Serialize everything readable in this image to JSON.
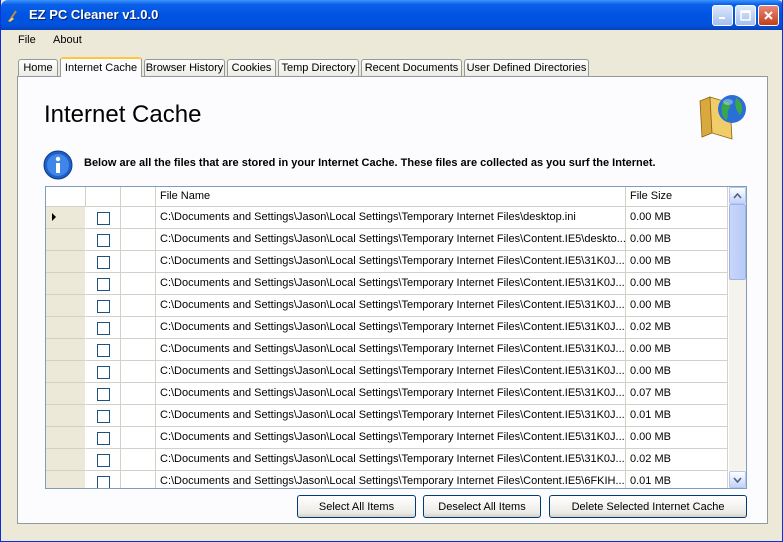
{
  "window": {
    "title": "EZ PC Cleaner v1.0.0"
  },
  "menu": {
    "items": [
      "File",
      "About"
    ]
  },
  "tabs": [
    {
      "label": "Home"
    },
    {
      "label": "Internet Cache"
    },
    {
      "label": "Browser History"
    },
    {
      "label": "Cookies"
    },
    {
      "label": "Temp Directory"
    },
    {
      "label": "Recent Documents"
    },
    {
      "label": "User Defined Directories"
    }
  ],
  "active_tab": "Internet Cache",
  "panel": {
    "heading": "Internet Cache",
    "info_text": "Below are all the files that are stored in your Internet Cache. These files are collected as you surf the Internet."
  },
  "grid": {
    "columns": [
      "File Name",
      "File Size"
    ],
    "rows": [
      {
        "file": "C:\\Documents and Settings\\Jason\\Local Settings\\Temporary Internet Files\\desktop.ini",
        "size": "0.00 MB"
      },
      {
        "file": "C:\\Documents and Settings\\Jason\\Local Settings\\Temporary Internet Files\\Content.IE5\\deskto...",
        "size": "0.00 MB"
      },
      {
        "file": "C:\\Documents and Settings\\Jason\\Local Settings\\Temporary Internet Files\\Content.IE5\\31K0J...",
        "size": "0.00 MB"
      },
      {
        "file": "C:\\Documents and Settings\\Jason\\Local Settings\\Temporary Internet Files\\Content.IE5\\31K0J...",
        "size": "0.00 MB"
      },
      {
        "file": "C:\\Documents and Settings\\Jason\\Local Settings\\Temporary Internet Files\\Content.IE5\\31K0J...",
        "size": "0.00 MB"
      },
      {
        "file": "C:\\Documents and Settings\\Jason\\Local Settings\\Temporary Internet Files\\Content.IE5\\31K0J...",
        "size": "0.02 MB"
      },
      {
        "file": "C:\\Documents and Settings\\Jason\\Local Settings\\Temporary Internet Files\\Content.IE5\\31K0J...",
        "size": "0.00 MB"
      },
      {
        "file": "C:\\Documents and Settings\\Jason\\Local Settings\\Temporary Internet Files\\Content.IE5\\31K0J...",
        "size": "0.00 MB"
      },
      {
        "file": "C:\\Documents and Settings\\Jason\\Local Settings\\Temporary Internet Files\\Content.IE5\\31K0J...",
        "size": "0.07 MB"
      },
      {
        "file": "C:\\Documents and Settings\\Jason\\Local Settings\\Temporary Internet Files\\Content.IE5\\31K0J...",
        "size": "0.01 MB"
      },
      {
        "file": "C:\\Documents and Settings\\Jason\\Local Settings\\Temporary Internet Files\\Content.IE5\\31K0J...",
        "size": "0.00 MB"
      },
      {
        "file": "C:\\Documents and Settings\\Jason\\Local Settings\\Temporary Internet Files\\Content.IE5\\31K0J...",
        "size": "0.02 MB"
      },
      {
        "file": "C:\\Documents and Settings\\Jason\\Local Settings\\Temporary Internet Files\\Content.IE5\\6FKIH...",
        "size": "0.01 MB"
      }
    ]
  },
  "buttons": {
    "select_all": "Select All Items",
    "deselect_all": "Deselect All Items",
    "delete_selected": "Delete Selected Internet Cache"
  },
  "icons": {
    "app": "broom-icon",
    "folder": "folder-globe-icon",
    "info": "info-icon"
  }
}
